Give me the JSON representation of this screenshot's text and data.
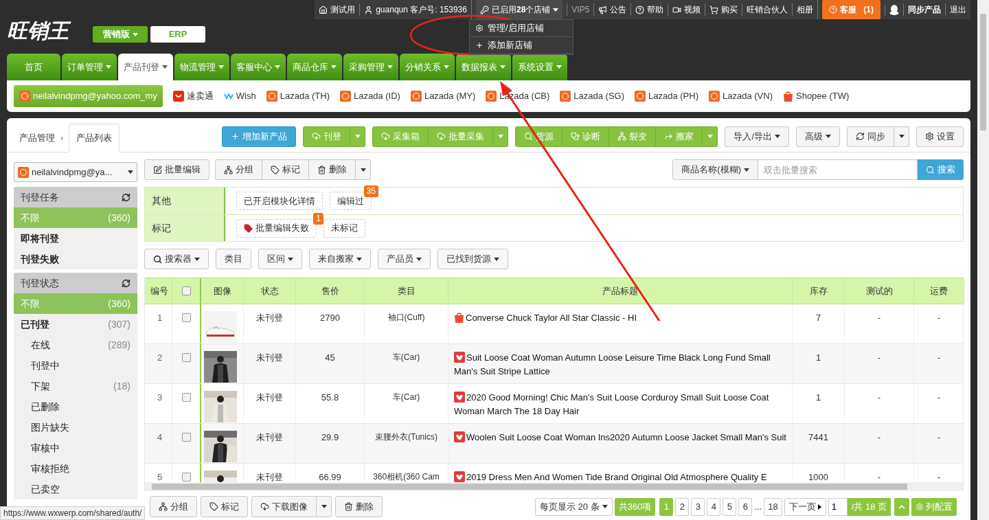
{
  "top_bar": {
    "items": [
      {
        "kind": "link",
        "label": "测试用"
      },
      {
        "kind": "link",
        "label": "guanqun 客户号: 153936"
      },
      {
        "kind": "dropdown",
        "label": "已启用**28**个店铺",
        "expanded": true
      },
      {
        "kind": "muted",
        "label": "VIP5"
      },
      {
        "kind": "link",
        "label": "公告"
      },
      {
        "kind": "link",
        "label": "帮助"
      },
      {
        "kind": "link",
        "label": "视频"
      },
      {
        "kind": "link",
        "label": "购买"
      },
      {
        "kind": "link",
        "label": "旺销合伙人"
      },
      {
        "kind": "link",
        "label": "相册"
      },
      {
        "kind": "service",
        "label": "客服",
        "count": "(1)"
      },
      {
        "kind": "qq"
      },
      {
        "kind": "bold",
        "label": "同步产品"
      },
      {
        "kind": "link",
        "label": "退出"
      }
    ],
    "store_menu": [
      {
        "label": "管理/启用店铺"
      },
      {
        "label": "添加新店铺"
      }
    ]
  },
  "logo": {
    "text": "旺销王"
  },
  "editions": [
    {
      "label": "营销版",
      "selected": true
    },
    {
      "label": "ERP",
      "selected": false
    }
  ],
  "nav_tabs": [
    {
      "label": "首页",
      "selected": false,
      "dropdown": false
    },
    {
      "label": "订单管理",
      "selected": false,
      "dropdown": true
    },
    {
      "label": "产品刊登",
      "selected": true,
      "dropdown": true
    },
    {
      "label": "物流管理",
      "selected": false,
      "dropdown": true
    },
    {
      "label": "客服中心",
      "selected": false,
      "dropdown": true
    },
    {
      "label": "商品仓库",
      "selected": false,
      "dropdown": true
    },
    {
      "label": "采购管理",
      "selected": false,
      "dropdown": true
    },
    {
      "label": "分销关系",
      "selected": false,
      "dropdown": true
    },
    {
      "label": "数据报表",
      "selected": false,
      "dropdown": true
    },
    {
      "label": "系统设置",
      "selected": false,
      "dropdown": true
    }
  ],
  "platforms": [
    {
      "kind": "lazada",
      "label": "neilalvindpmg@yahoo.com_my",
      "selected": true
    },
    {
      "kind": "aliexpress",
      "label": "速卖通",
      "selected": false
    },
    {
      "kind": "wish",
      "label": "Wish",
      "selected": false
    },
    {
      "kind": "lazada",
      "label": "Lazada (TH)",
      "selected": false
    },
    {
      "kind": "lazada",
      "label": "Lazada (ID)",
      "selected": false
    },
    {
      "kind": "lazada",
      "label": "Lazada (MY)",
      "selected": false
    },
    {
      "kind": "lazada",
      "label": "Lazada (CB)",
      "selected": false
    },
    {
      "kind": "lazada",
      "label": "Lazada (SG)",
      "selected": false
    },
    {
      "kind": "lazada",
      "label": "Lazada (PH)",
      "selected": false
    },
    {
      "kind": "lazada",
      "label": "Lazada (VN)",
      "selected": false
    },
    {
      "kind": "shopee",
      "label": "Shopee (TW)",
      "selected": false
    }
  ],
  "breadcrumb": {
    "parent": "产品管理",
    "separator": "›",
    "tabs": [
      {
        "label": "产品列表",
        "selected": true
      }
    ]
  },
  "toolbar_groups": [
    {
      "kind": "primary",
      "buttons": [
        "增加新产品"
      ],
      "split": false,
      "caret": false
    },
    {
      "kind": "action",
      "buttons": [
        "刊登"
      ],
      "split": true,
      "caret": false
    },
    {
      "kind": "action",
      "buttons": [
        "采集箱",
        "批量采集"
      ],
      "split": true,
      "caret": false
    },
    {
      "kind": "action",
      "buttons": [
        "货源",
        "诊断",
        "裂变",
        "搬家"
      ],
      "split": true,
      "caret": false
    },
    {
      "kind": "plain",
      "buttons": [
        "导入/导出"
      ],
      "split": false,
      "caret": true
    },
    {
      "kind": "plain",
      "buttons": [
        "高级"
      ],
      "split": false,
      "caret": true
    },
    {
      "kind": "plain",
      "buttons": [
        "同步"
      ],
      "split": true,
      "caret": false
    },
    {
      "kind": "plain",
      "buttons": [
        "设置"
      ],
      "split": false,
      "caret": false
    }
  ],
  "account_select": {
    "value": "neilalvindpmg@ya..."
  },
  "bulk_actions": {
    "buttons": [
      "批量编辑",
      "分组",
      "标记",
      "删除"
    ],
    "split": true
  },
  "search": {
    "field": "商品名称(模糊)",
    "placeholder": "双击批量搜索",
    "button": "搜索"
  },
  "filters": [
    {
      "label": "其他",
      "tags": [
        {
          "kind": "plain",
          "label": "已开启模块化详情"
        },
        {
          "kind": "plain",
          "label": "编辑过",
          "badge": "35"
        }
      ]
    },
    {
      "label": "标记",
      "tags": [
        {
          "kind": "tagged",
          "label": "批量编辑失败",
          "badge": "1"
        },
        {
          "kind": "plain",
          "label": "未标记"
        }
      ]
    }
  ],
  "filter_dropdowns": [
    {
      "kind": "search",
      "label": "搜索器",
      "caret": true
    },
    {
      "kind": "plain",
      "label": "类目",
      "caret": false
    },
    {
      "kind": "plain",
      "label": "区间",
      "caret": true
    },
    {
      "kind": "plain",
      "label": "来自搬家",
      "caret": true
    },
    {
      "kind": "plain",
      "label": "产品员",
      "caret": true
    },
    {
      "kind": "plain",
      "label": "已找到货源",
      "caret": true
    }
  ],
  "sidebar": {
    "sections": [
      {
        "title": "刊登任务",
        "items": [
          {
            "label": "不限",
            "count": "(360)",
            "selected": true,
            "bold": false
          },
          {
            "label": "即将刊登",
            "selected": false,
            "bold": true
          },
          {
            "label": "刊登失败",
            "selected": false,
            "bold": true
          }
        ]
      },
      {
        "title": "刊登状态",
        "items": [
          {
            "label": "不限",
            "count": "(360)",
            "selected": true,
            "bold": false
          },
          {
            "label": "已刊登",
            "count": "(307)",
            "selected": false,
            "bold": true,
            "children": [
              {
                "label": "在线",
                "count": "(289)",
                "selected": false,
                "bold": false
              },
              {
                "label": "刊登中",
                "selected": false,
                "bold": false
              },
              {
                "label": "下架",
                "count": "(18)",
                "selected": false,
                "bold": false
              },
              {
                "label": "已删除",
                "selected": false,
                "bold": false
              },
              {
                "label": "图片缺失",
                "selected": false,
                "bold": false
              },
              {
                "label": "审核中",
                "selected": false,
                "bold": false
              },
              {
                "label": "审核拒绝",
                "selected": false,
                "bold": false
              },
              {
                "label": "已卖空",
                "selected": false,
                "bold": false
              }
            ]
          }
        ]
      }
    ]
  },
  "table": {
    "columns": [
      "编号",
      "图像",
      "状态",
      "售价",
      "类目",
      "产品标题",
      "库存",
      "测试的",
      "运费"
    ],
    "header_checked": false,
    "rows": [
      {
        "no": "1",
        "checked": false,
        "status": "未刊登",
        "price": "2790",
        "category": "袖口(Cuff)",
        "kind": "shopee",
        "title": "Converse Chuck Taylor All Star Classic  - HI",
        "stock": "7",
        "tested": "-",
        "shipping": "-"
      },
      {
        "no": "2",
        "checked": false,
        "status": "未刊登",
        "price": "45",
        "category": "车(Car)",
        "kind": "other",
        "title": "Suit Loose Coat Woman Autumn Loose Leisure Time Black Long Fund Small Man's Suit Stripe Lattice",
        "stock": "1",
        "tested": "-",
        "shipping": "-"
      },
      {
        "no": "3",
        "checked": false,
        "status": "未刊登",
        "price": "55.8",
        "category": "车(Car)",
        "kind": "other",
        "title": "2020 Good Morning! Chic Man's Suit Loose Corduroy Small Suit Loose Coat Woman March The 18 Day Hair",
        "stock": "1",
        "tested": "-",
        "shipping": "-"
      },
      {
        "no": "4",
        "checked": false,
        "status": "未刊登",
        "price": "29.9",
        "category": "束腰外衣(Tunics)",
        "kind": "other",
        "title": "Woolen Suit Loose Coat Woman Ins2020 Autumn Loose Jacket Small Man's Suit",
        "stock": "7441",
        "tested": "-",
        "shipping": "-"
      },
      {
        "no": "5",
        "checked": false,
        "status": "未刊登",
        "price": "66.99",
        "category": "360相机(360 Cam",
        "kind": "other",
        "title": "2019 Dress Men And Women Tide Brand Original Old Atmosphere Quality E",
        "stock": "1000",
        "tested": "-",
        "shipping": "-"
      }
    ]
  },
  "bottom_actions": {
    "buttons": [
      {
        "label": "分组",
        "split": false
      },
      {
        "label": "标记",
        "split": false
      },
      {
        "label": "下载图像",
        "split": true
      },
      {
        "label": "删除",
        "split": false
      }
    ]
  },
  "pagination": {
    "page_size": "每页显示 20 条",
    "total": "共360项",
    "pages": [
      {
        "label": "1",
        "selected": true
      },
      {
        "label": "2",
        "selected": false
      },
      {
        "label": "3",
        "selected": false
      },
      {
        "label": "4",
        "selected": false
      },
      {
        "label": "5",
        "selected": false
      },
      {
        "label": "6",
        "selected": false
      }
    ],
    "ellipsis": "...",
    "last_page": "18",
    "next": "下一页",
    "page_input": "1",
    "page_count": "/共 18 页",
    "column_config": "列配置"
  },
  "status_url": "https://www.wxwerp.com/shared/auth/"
}
